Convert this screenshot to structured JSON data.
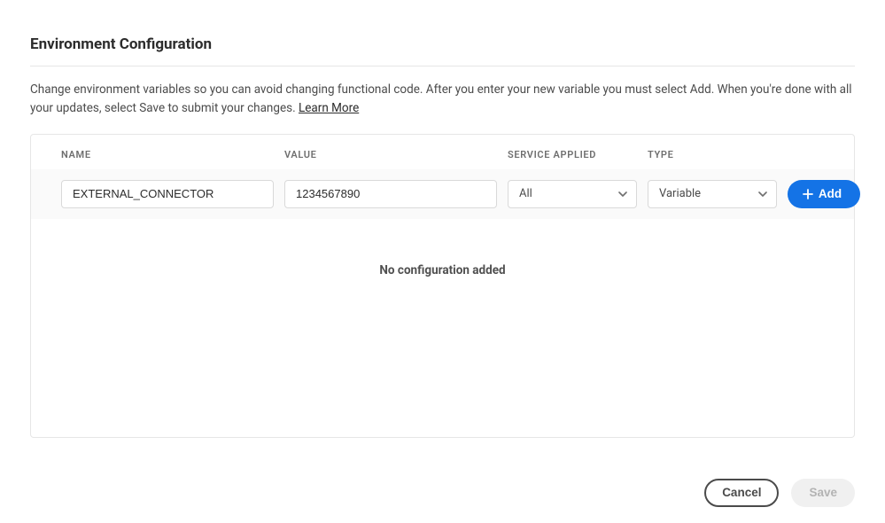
{
  "header": {
    "title": "Environment Configuration",
    "description_main": "Change environment variables so you can avoid changing functional code. After you enter your new variable you must select Add. When you're done with all your updates, select Save to submit your changes. ",
    "learn_more": "Learn More"
  },
  "table": {
    "columns": {
      "name": "NAME",
      "value": "VALUE",
      "service_applied": "SERVICE APPLIED",
      "type": "TYPE"
    },
    "input_row": {
      "name_value": "EXTERNAL_CONNECTOR",
      "value_value": "1234567890",
      "service_selected": "All",
      "type_selected": "Variable",
      "add_label": "Add"
    },
    "empty_state": "No configuration added"
  },
  "footer": {
    "cancel": "Cancel",
    "save": "Save"
  },
  "colors": {
    "primary": "#1473e6",
    "border": "#e6e6e6",
    "text": "#2c2c2c",
    "muted": "#6e6e6e"
  }
}
